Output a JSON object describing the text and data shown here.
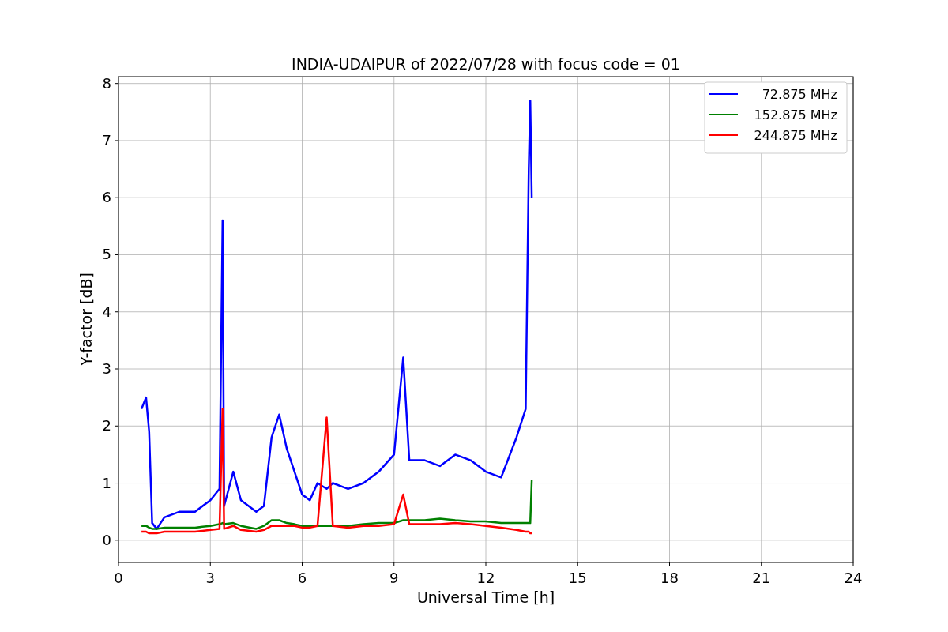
{
  "figure": {
    "chart_data": {
      "type": "line",
      "title": "INDIA-UDAIPUR of 2022/07/28 with focus code = 01",
      "xlabel": "Universal Time [h]",
      "ylabel": "Y-factor [dB]",
      "x": [
        0.75,
        0.9,
        1.0,
        1.1,
        1.25,
        1.5,
        2.0,
        2.5,
        3.0,
        3.3,
        3.4,
        3.45,
        3.75,
        4.0,
        4.5,
        4.75,
        5.0,
        5.25,
        5.5,
        5.75,
        6.0,
        6.25,
        6.5,
        6.8,
        7.0,
        7.5,
        8.0,
        8.5,
        9.0,
        9.3,
        9.5,
        10.0,
        10.5,
        11.0,
        11.5,
        12.0,
        12.5,
        13.0,
        13.3,
        13.4,
        13.45,
        13.5
      ],
      "series": [
        {
          "name": "72.875 MHz",
          "color": "#0000ff",
          "values": [
            2.3,
            2.5,
            1.9,
            0.3,
            0.2,
            0.4,
            0.5,
            0.5,
            0.7,
            0.9,
            5.6,
            0.6,
            1.2,
            0.7,
            0.5,
            0.6,
            1.8,
            2.2,
            1.6,
            1.2,
            0.8,
            0.7,
            1.0,
            0.9,
            1.0,
            0.9,
            1.0,
            1.2,
            1.5,
            3.2,
            1.4,
            1.4,
            1.3,
            1.5,
            1.4,
            1.2,
            1.1,
            1.8,
            2.3,
            6.5,
            7.7,
            6.0
          ]
        },
        {
          "name": "152.875 MHz",
          "color": "#008000",
          "values": [
            0.25,
            0.25,
            0.22,
            0.2,
            0.2,
            0.22,
            0.22,
            0.22,
            0.25,
            0.28,
            0.3,
            0.28,
            0.3,
            0.25,
            0.2,
            0.25,
            0.35,
            0.35,
            0.3,
            0.28,
            0.25,
            0.25,
            0.25,
            0.25,
            0.25,
            0.25,
            0.28,
            0.3,
            0.3,
            0.35,
            0.35,
            0.35,
            0.38,
            0.35,
            0.33,
            0.33,
            0.3,
            0.3,
            0.3,
            0.3,
            0.3,
            1.05
          ]
        },
        {
          "name": "244.875 MHz",
          "color": "#ff0000",
          "values": [
            0.15,
            0.15,
            0.12,
            0.12,
            0.12,
            0.15,
            0.15,
            0.15,
            0.18,
            0.2,
            2.3,
            0.2,
            0.25,
            0.18,
            0.15,
            0.18,
            0.25,
            0.25,
            0.25,
            0.25,
            0.22,
            0.22,
            0.25,
            2.15,
            0.25,
            0.22,
            0.25,
            0.25,
            0.28,
            0.8,
            0.28,
            0.28,
            0.28,
            0.3,
            0.28,
            0.25,
            0.22,
            0.18,
            0.15,
            0.15,
            0.12,
            0.12
          ]
        }
      ],
      "grid": true,
      "legend": true,
      "xlim": [
        0,
        24
      ],
      "ylim": [
        -0.39,
        8.12
      ],
      "xticks": [
        0,
        3,
        6,
        9,
        12,
        15,
        18,
        21,
        24
      ],
      "yticks": [
        0,
        1,
        2,
        3,
        4,
        5,
        6,
        7,
        8
      ]
    }
  }
}
